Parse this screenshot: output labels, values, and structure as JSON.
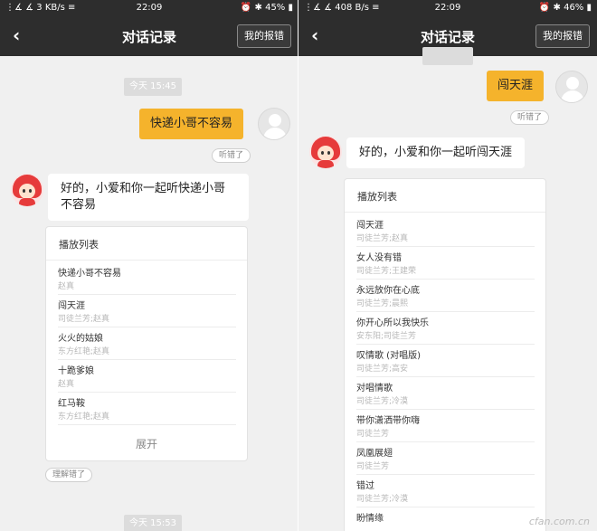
{
  "left": {
    "status": {
      "signal": "⋮∡ ∡ 3 KB/s ≡",
      "time": "22:09",
      "right": "⏰ ✱ 45% ▮"
    },
    "nav": {
      "back": "‹",
      "title": "对话记录",
      "report": "我的报错"
    },
    "time1": "今天 15:45",
    "user_message": "快递小哥不容易",
    "user_feedback": "听错了",
    "bot_message": "好的，小爱和你一起听快递小哥不容易",
    "playlist": {
      "title": "播放列表",
      "songs": [
        {
          "name": "快递小哥不容易",
          "artist": "赵真"
        },
        {
          "name": "闯天涯",
          "artist": "司徒兰芳;赵真"
        },
        {
          "name": "火火的姑娘",
          "artist": "东方红艳;赵真"
        },
        {
          "name": "十跪爹娘",
          "artist": "赵真"
        },
        {
          "name": "红马鞍",
          "artist": "东方红艳;赵真"
        }
      ],
      "expand": "展开"
    },
    "bot_feedback": "理解错了",
    "time2": "今天 15:53"
  },
  "right": {
    "status": {
      "signal": "⋮∡ ∡ 408 B/s ≡",
      "time": "22:09",
      "right": "⏰ ✱ 46% ▮"
    },
    "nav": {
      "back": "‹",
      "title": "对话记录",
      "report": "我的报错"
    },
    "user_message": "闯天涯",
    "user_feedback": "听错了",
    "bot_message": "好的，小爱和你一起听闯天涯",
    "playlist": {
      "title": "播放列表",
      "songs": [
        {
          "name": "闯天涯",
          "artist": "司徒兰芳;赵真"
        },
        {
          "name": "女人没有错",
          "artist": "司徒兰芳;王建荣"
        },
        {
          "name": "永远放你在心底",
          "artist": "司徒兰芳;晨熙"
        },
        {
          "name": "你开心所以我快乐",
          "artist": "安东阳;司徒兰芳"
        },
        {
          "name": "叹情歌 (对唱版)",
          "artist": "司徒兰芳;高安"
        },
        {
          "name": "对唱情歌",
          "artist": "司徒兰芳;冷漠"
        },
        {
          "name": "带你潇洒带你嗨",
          "artist": "司徒兰芳"
        },
        {
          "name": "凤凰展翅",
          "artist": "司徒兰芳"
        },
        {
          "name": "错过",
          "artist": "司徒兰芳;冷漠"
        },
        {
          "name": "盼情缘",
          "artist": ""
        }
      ]
    }
  },
  "watermark": "cfan.com.cn"
}
